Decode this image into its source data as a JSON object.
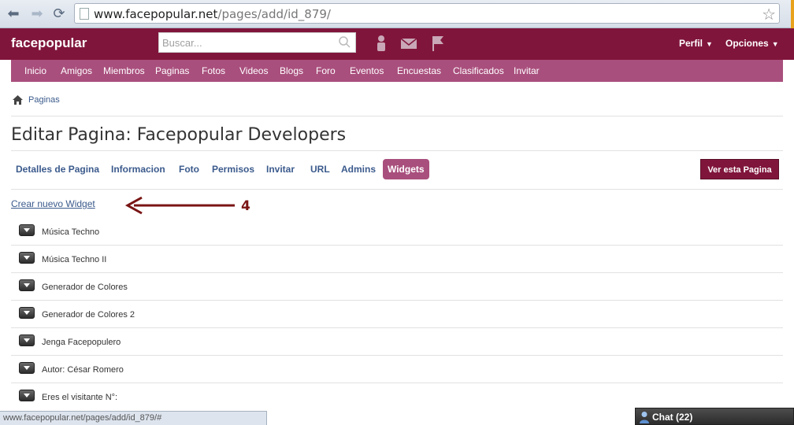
{
  "browser": {
    "url_host": "www.facepopular.net",
    "url_path": "/pages/add/id_879/"
  },
  "header": {
    "logo": "facepopular",
    "search_placeholder": "Buscar...",
    "menu_perfil": "Perfil",
    "menu_opciones": "Opciones"
  },
  "nav": {
    "items": [
      "Inicio",
      "Amigos",
      "Miembros",
      "Paginas",
      "Fotos",
      "Videos",
      "Blogs",
      "Foro",
      "Eventos",
      "Encuestas",
      "Clasificados",
      "Invitar"
    ]
  },
  "breadcrumb": {
    "label": "Paginas"
  },
  "page": {
    "title": "Editar Pagina: Facepopular Developers",
    "tabs": [
      "Detalles de Pagina",
      "Informacion",
      "Foto",
      "Permisos",
      "Invitar",
      "URL",
      "Admins",
      "Widgets"
    ],
    "active_tab": "Widgets",
    "view_button": "Ver esta Pagina",
    "create_link": "Crear nuevo Widget",
    "annotation": "4"
  },
  "widgets": [
    "Música Techno",
    "Música Techno II",
    "Generador de Colores",
    "Generador de Colores 2",
    "Jenga Facepopulero",
    "Autor: César Romero",
    "Eres el visitante N°:"
  ],
  "status": {
    "hover_url": "www.facepopular.net/pages/add/id_879/#",
    "chat_label": "Chat (22)"
  },
  "colors": {
    "brand": "#80153b",
    "nav": "#a94f7d",
    "link": "#3b5a8c",
    "annotation": "#7a1414"
  }
}
